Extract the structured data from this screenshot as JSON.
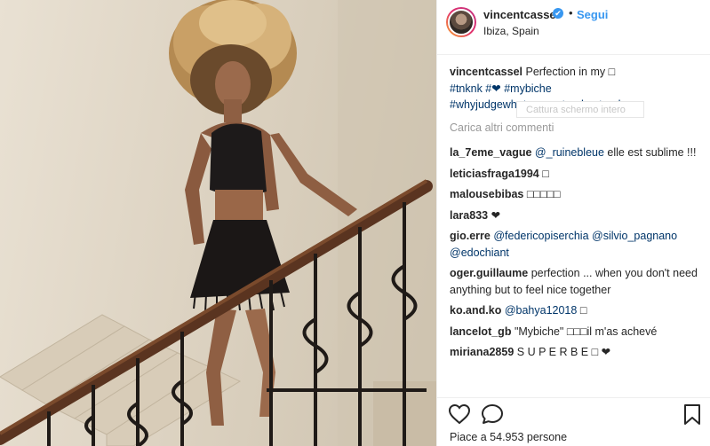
{
  "post": {
    "username": "vincentcassel",
    "verified_glyph": "✔",
    "separator": "•",
    "follow_label": "Segui",
    "location": "Ibiza, Spain"
  },
  "caption": {
    "username": "vincentcassel",
    "text": "Perfection in my □",
    "hashtags_line1": "#tnknk #❤ #mybiche",
    "hashtags_line2": "#whyjudgewhatyoucantunderstand"
  },
  "load_more": "Carica altri commenti",
  "tooltip": "Cattura schermo intero",
  "comments": [
    {
      "user": "la_7eme_vague",
      "mention": "@_ruinebleue",
      "text": " elle est sublime !!!"
    },
    {
      "user": "leticiasfraga1994",
      "text": "□"
    },
    {
      "user": "malousebibas",
      "text": "□□□□□"
    },
    {
      "user": "lara833",
      "text": "❤"
    },
    {
      "user": "gio.erre",
      "mention": "@federicopiserchia @silvio_pagnano @edochiant",
      "text": ""
    },
    {
      "user": "oger.guillaume",
      "text": "perfection ... when you don't need anything but to feel nice together"
    },
    {
      "user": "ko.and.ko",
      "mention": "@bahya12018",
      "text": " □"
    },
    {
      "user": "lancelot_gb",
      "text": "\"Mybiche\" □□□il m'as achevé"
    },
    {
      "user": "miriana2859",
      "text": "S U P E R B E □ ❤"
    }
  ],
  "likes_text": "Piace a 54.953 persone",
  "icons": {
    "like": "heart-icon",
    "comment": "comment-icon",
    "save": "bookmark-icon",
    "verified": "verified-badge-icon"
  },
  "colors": {
    "link": "#3897f0",
    "hashtag": "#003569",
    "muted": "#999999",
    "text": "#262626"
  }
}
